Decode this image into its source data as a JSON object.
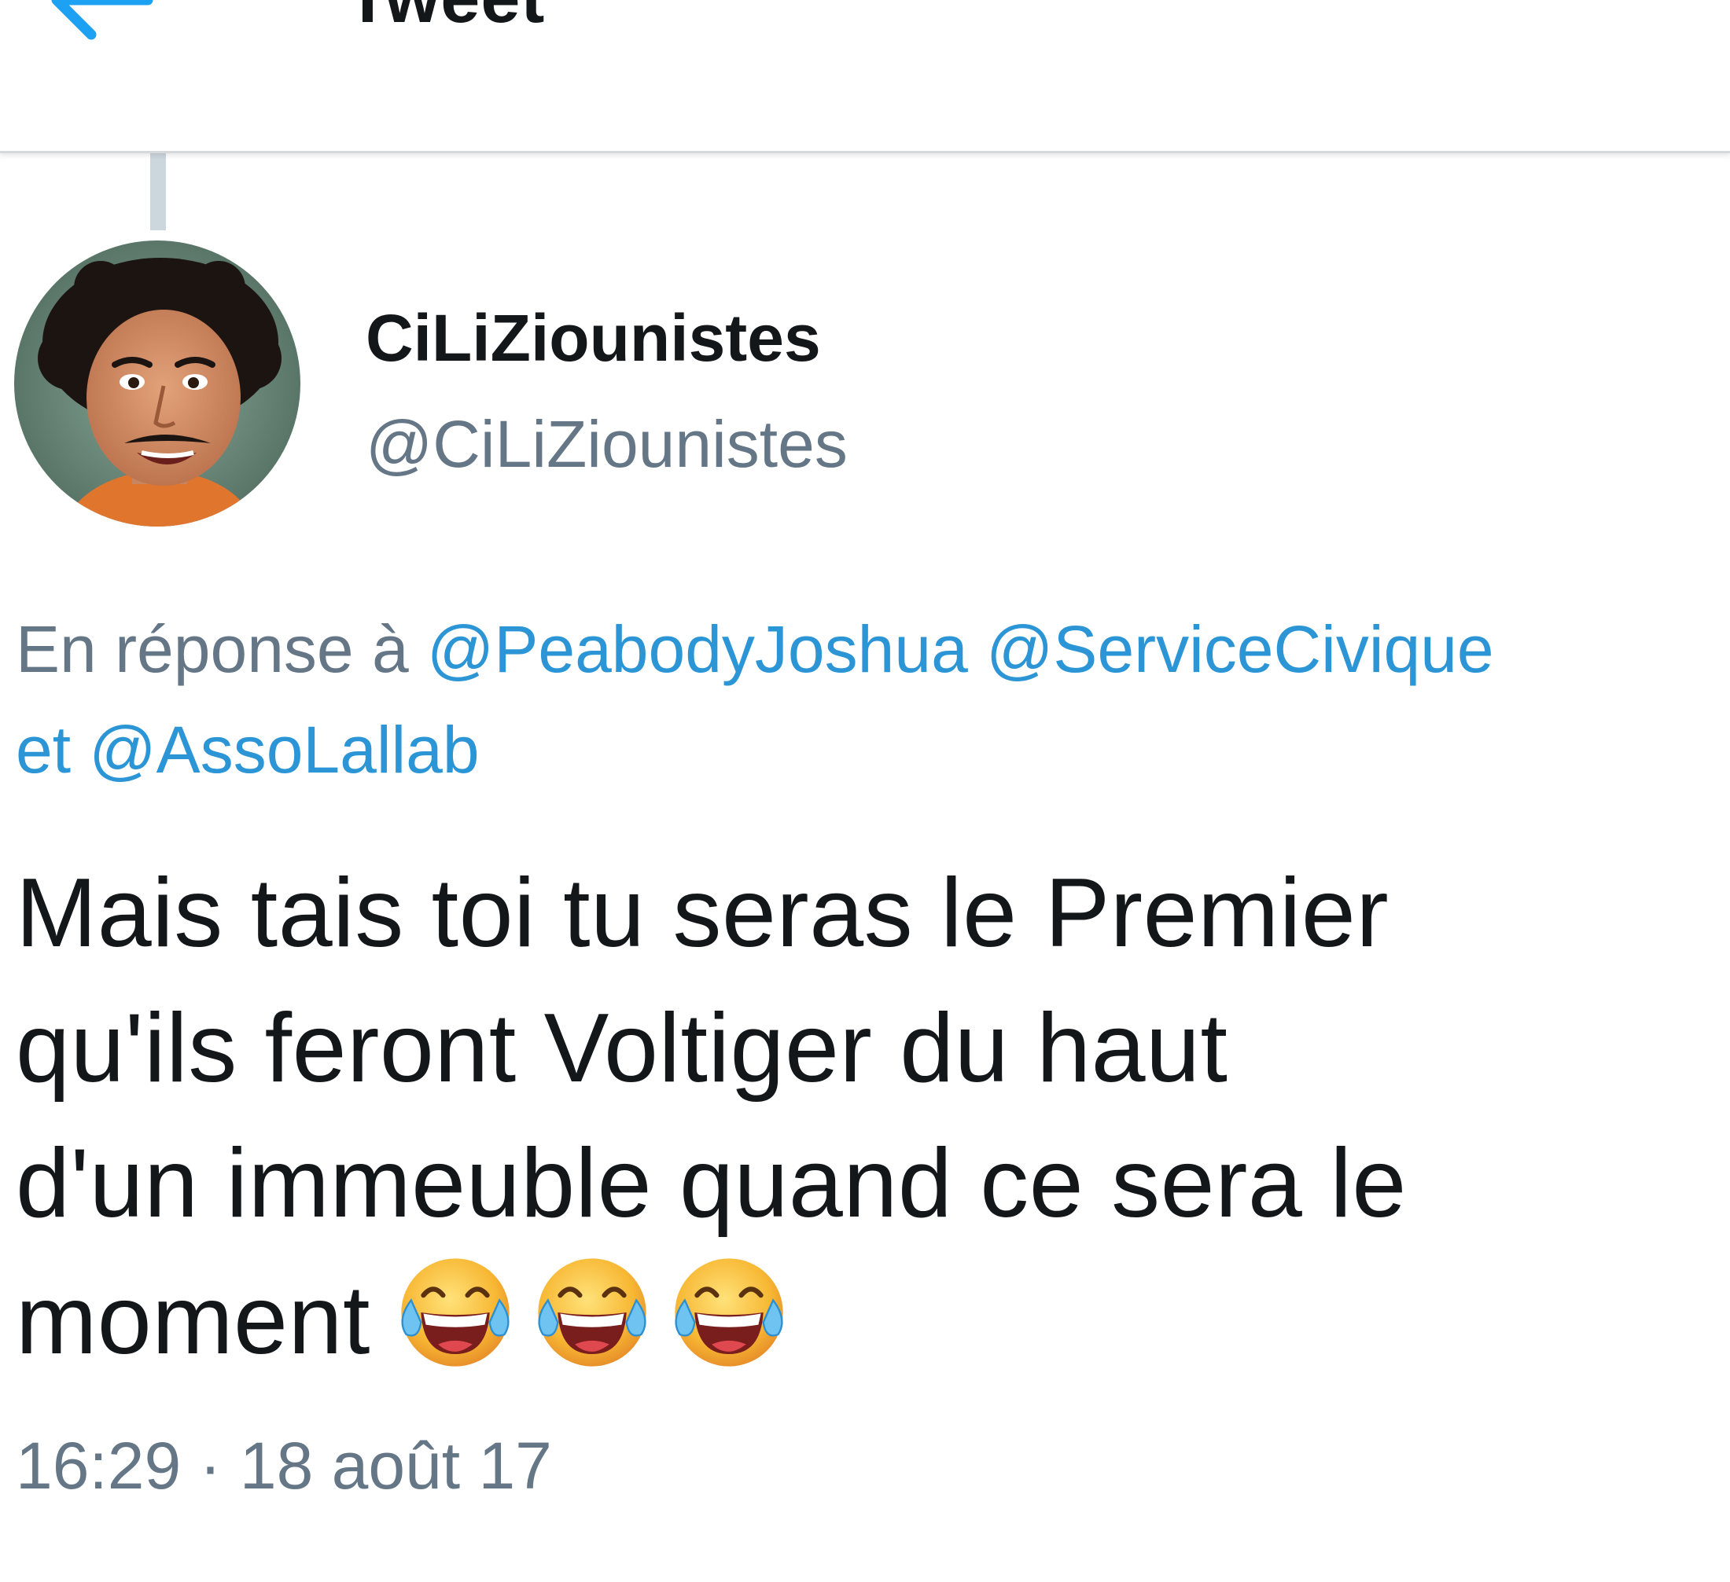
{
  "header": {
    "title": "Tweet",
    "back_icon": "arrow-left-icon"
  },
  "author": {
    "display_name": "CiLiZiounistes",
    "handle": "@CiLiZiounistes",
    "avatar_icon": "profile-photo"
  },
  "reply_context": {
    "prefix": "En réponse à",
    "mentions": [
      "@PeabodyJoshua",
      "@ServiceCivique",
      "@AssoLallab"
    ],
    "conjunction": "et"
  },
  "tweet": {
    "lines": [
      "Mais tais toi tu seras le Premier",
      "qu'ils feront Voltiger du haut",
      "d'un immeuble quand ce sera le",
      "moment"
    ],
    "emoji": "face-with-tears-of-joy",
    "emoji_count": 3
  },
  "timestamp": "16:29 · 18 août 17",
  "colors": {
    "link": "#2b95d6",
    "secondary_text": "#657786",
    "primary_text": "#14171a",
    "thread_line": "#ccd6dd"
  }
}
